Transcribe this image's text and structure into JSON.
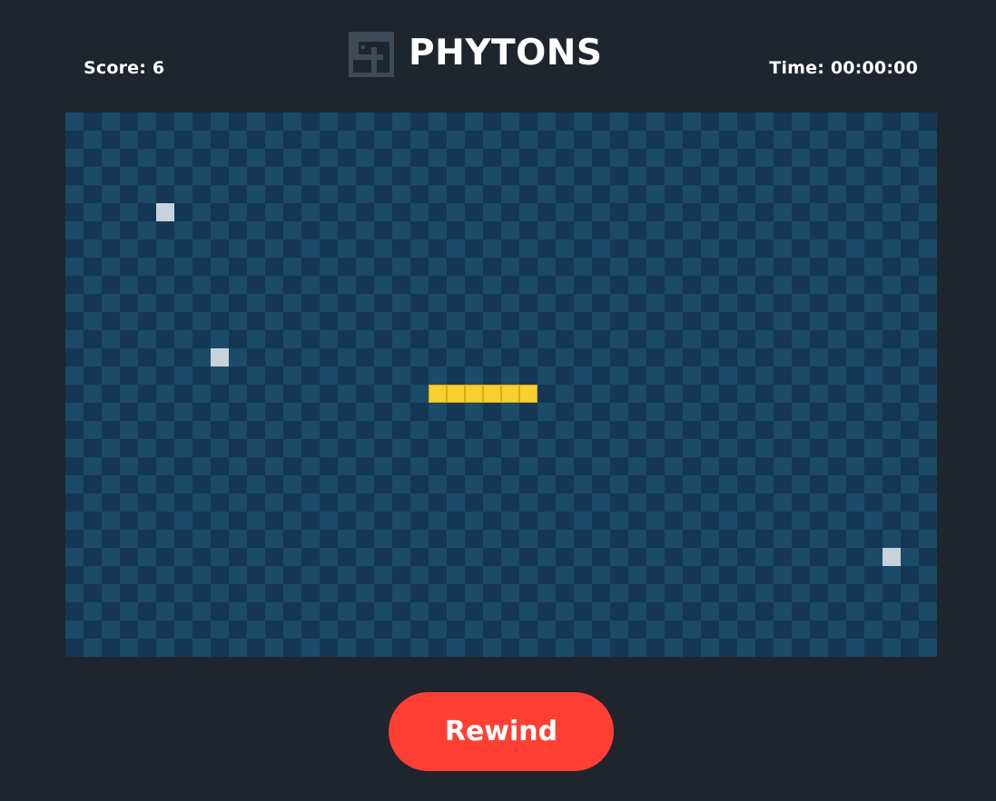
{
  "header": {
    "title": "PHYTONS",
    "score_text": "Score: 6",
    "time_text": "Time: 00:00:00",
    "logo_icon": "snake-logo-icon"
  },
  "game": {
    "score": 6,
    "elapsed": "00:00:00",
    "grid": {
      "cols": 48,
      "rows": 30
    },
    "snake": [
      {
        "col": 20,
        "row": 15
      },
      {
        "col": 21,
        "row": 15
      },
      {
        "col": 22,
        "row": 15
      },
      {
        "col": 23,
        "row": 15
      },
      {
        "col": 24,
        "row": 15
      },
      {
        "col": 25,
        "row": 15
      }
    ],
    "food": [
      {
        "col": 5,
        "row": 5
      },
      {
        "col": 8,
        "row": 13
      },
      {
        "col": 45,
        "row": 24
      }
    ]
  },
  "controls": {
    "rewind_label": "Rewind"
  },
  "colors": {
    "background": "#1f252d",
    "board_light": "#1c4a69",
    "board_dark": "#143755",
    "snake": "#f7cf2e",
    "food": "#c8d2da",
    "button": "#ff3f33",
    "logo": "#3d4b58"
  }
}
